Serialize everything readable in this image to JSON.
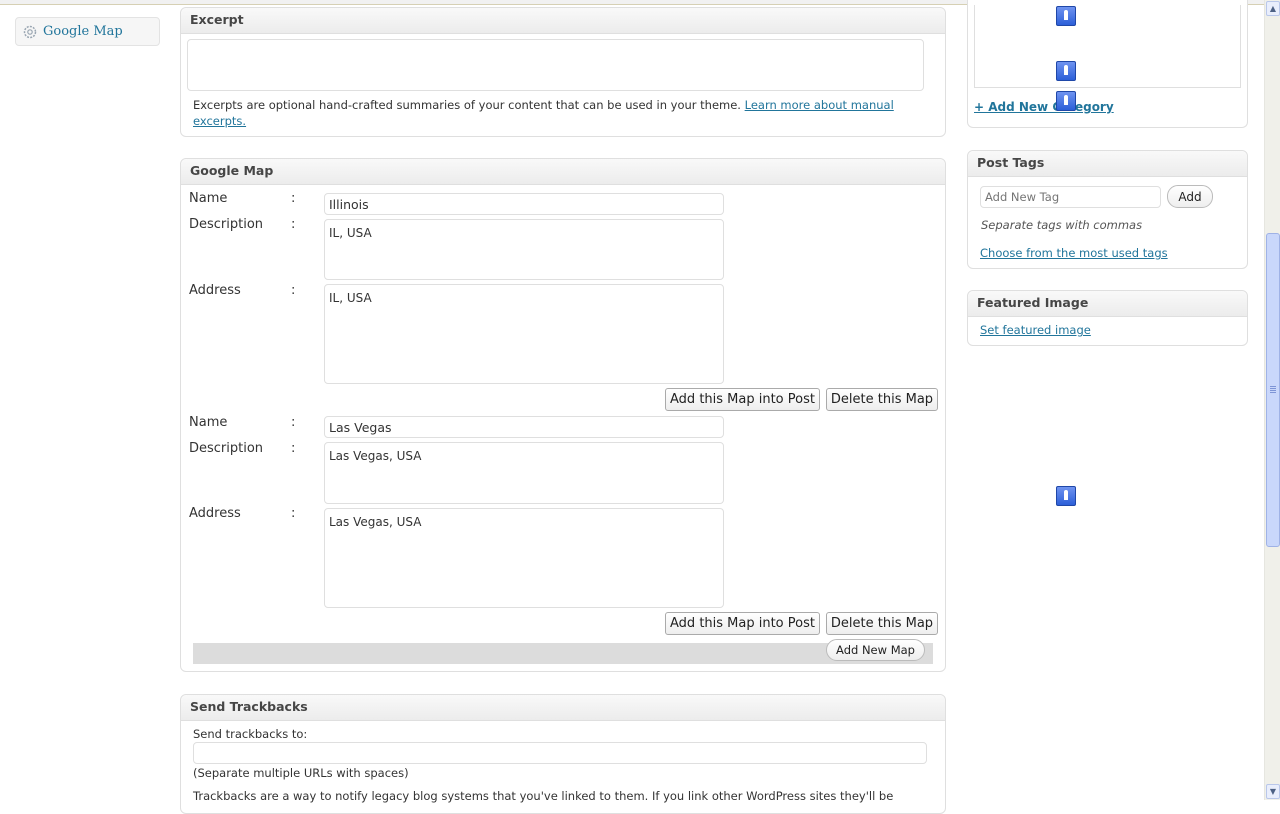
{
  "sidebar": {
    "google_map_label": "Google Map"
  },
  "excerpt": {
    "title": "Excerpt",
    "text": "",
    "help_text": "Excerpts are optional hand-crafted summaries of your content that can be used in your theme.",
    "help_link_line1": "Learn more about manual",
    "help_link_line2": "excerpts."
  },
  "google_map": {
    "title": "Google Map",
    "labels": {
      "name": "Name",
      "description": "Description",
      "address": "Address",
      "colon": ":"
    },
    "maps": [
      {
        "name": "Illinois",
        "description": "IL, USA",
        "address": "IL, USA",
        "add_button": "Add this Map into Post",
        "delete_button": "Delete this Map"
      },
      {
        "name": "Las Vegas",
        "description": "Las Vegas, USA",
        "address": "Las Vegas, USA",
        "add_button": "Add this Map into Post",
        "delete_button": "Delete this Map"
      }
    ],
    "add_new_button": "Add New Map"
  },
  "trackbacks": {
    "title": "Send Trackbacks",
    "label": "Send trackbacks to:",
    "value": "",
    "hint": "(Separate multiple URLs with spaces)",
    "info": "Trackbacks are a way to notify legacy blog systems that you've linked to them. If you link other WordPress sites they'll be"
  },
  "categories": {
    "add_new_link": "+ Add New Category"
  },
  "post_tags": {
    "title": "Post Tags",
    "placeholder": "Add New Tag",
    "add_button": "Add",
    "hint": "Separate tags with commas",
    "choose_link": "Choose from the most used tags"
  },
  "featured_image": {
    "title": "Featured Image",
    "link": "Set featured image"
  },
  "colors": {
    "link": "#21759b",
    "accent": "#2c5fd8"
  }
}
